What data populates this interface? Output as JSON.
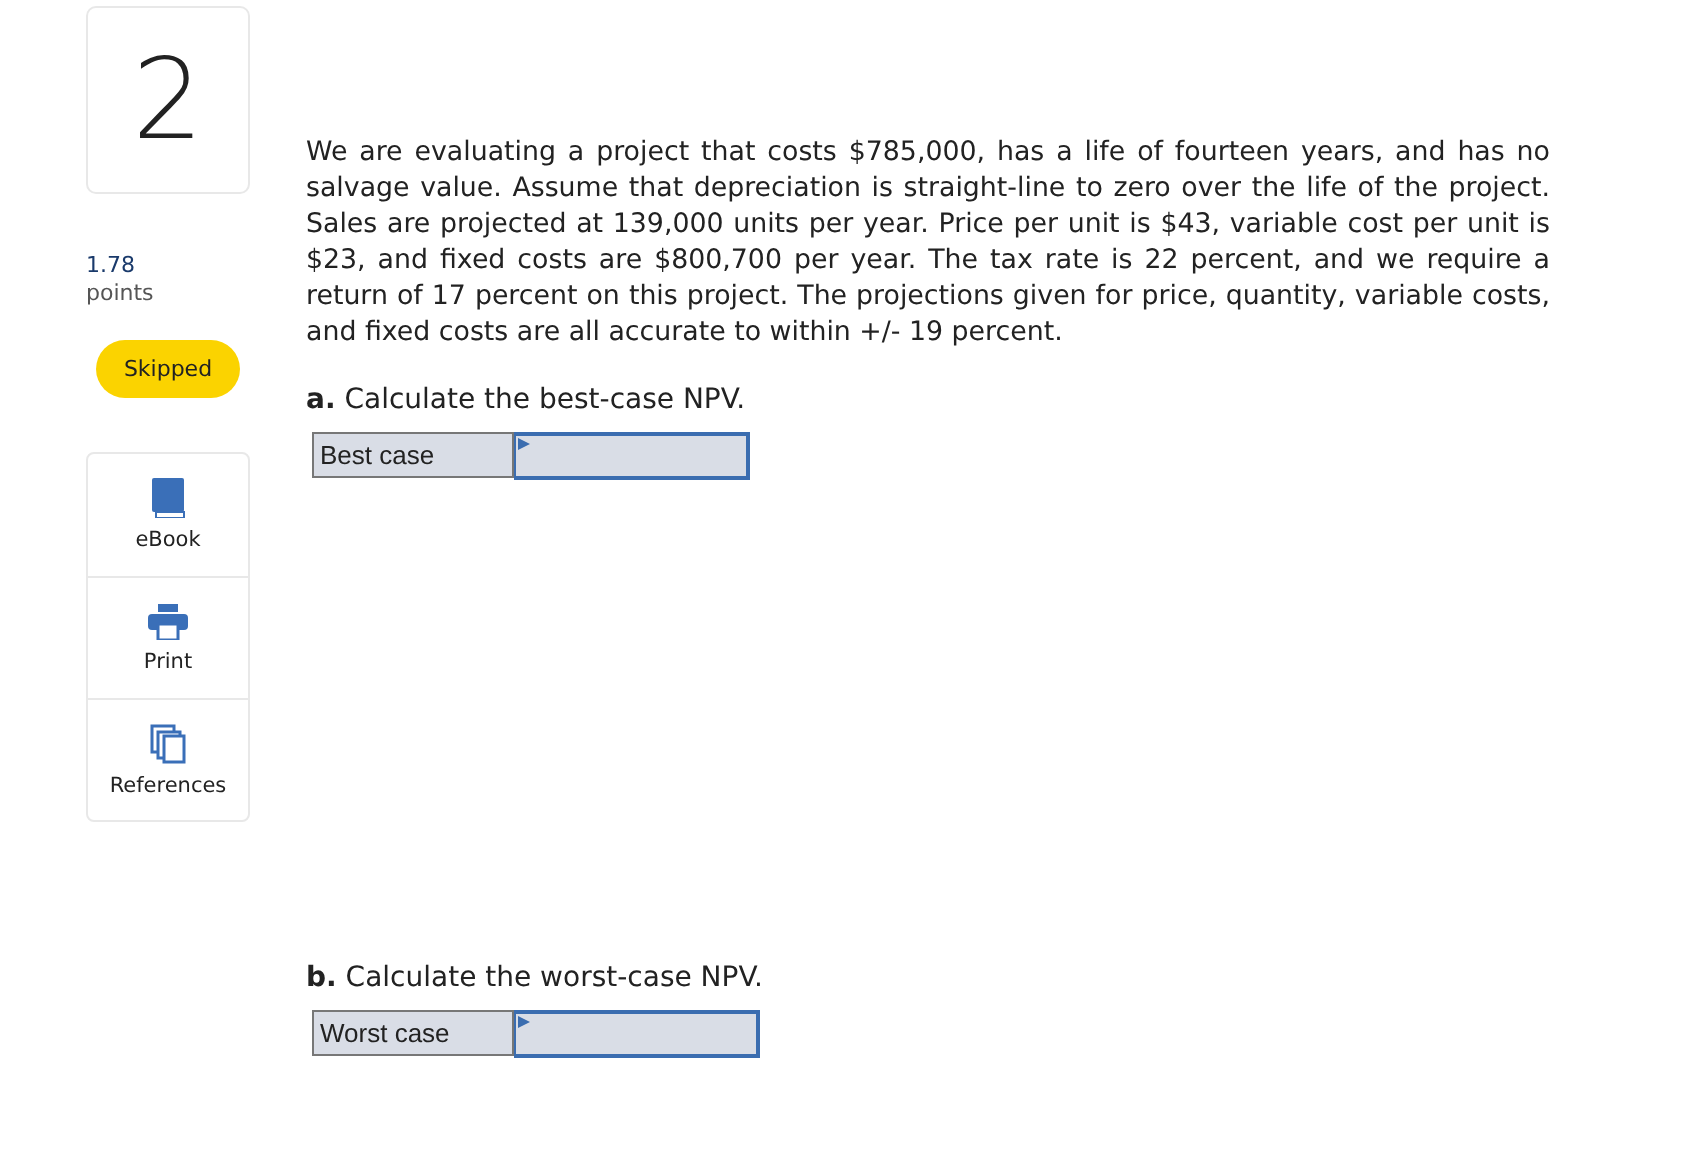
{
  "question": {
    "number": "2",
    "points_value": "1.78",
    "points_label": "points",
    "status": "Skipped"
  },
  "tools": [
    {
      "kind": "ebook",
      "label": "eBook"
    },
    {
      "kind": "print",
      "label": "Print"
    },
    {
      "kind": "references",
      "label": "References"
    }
  ],
  "problem": "We are evaluating a project that costs $785,000, has a life of fourteen years, and has no salvage value. Assume that depreciation is straight-line to zero over the life of the project. Sales are projected at 139,000 units per year. Price per unit is $43, variable cost per unit is $23, and fixed costs are $800,700 per year. The tax rate is 22 percent, and we require a return of 17 percent on this project. The projections given for price, quantity, variable costs, and fixed costs are all accurate to within +/- 19 percent.",
  "parts": [
    {
      "prompt": "**a.** Calculate the best-case NPV.",
      "label": "Best case"
    },
    {
      "prompt": "**b.** Calculate the worst-case NPV.",
      "label": "Worst case"
    }
  ]
}
